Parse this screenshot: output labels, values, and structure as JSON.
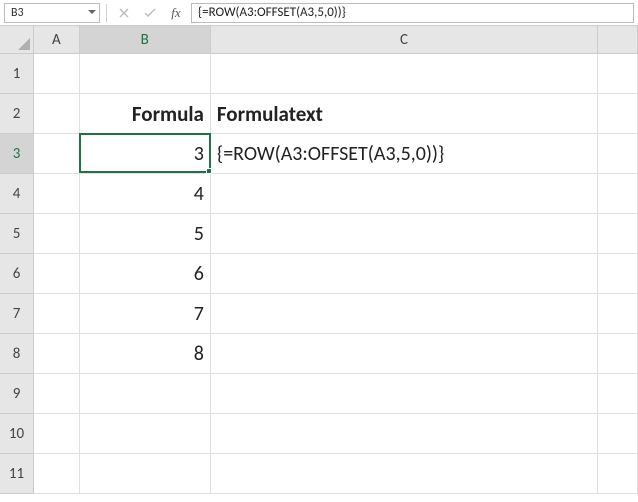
{
  "formula_bar": {
    "name_box": "B3",
    "formula": "{=ROW(A3:OFFSET(A3,5,0))}"
  },
  "columns": [
    {
      "label": "A",
      "width_class": "col-A",
      "active": false
    },
    {
      "label": "B",
      "width_class": "col-B",
      "active": true
    },
    {
      "label": "C",
      "width_class": "col-C",
      "active": false
    },
    {
      "label": "",
      "width_class": "col-D",
      "active": false
    }
  ],
  "rows": [
    {
      "label": "1",
      "active": false
    },
    {
      "label": "2",
      "active": false
    },
    {
      "label": "3",
      "active": true
    },
    {
      "label": "4",
      "active": false
    },
    {
      "label": "5",
      "active": false
    },
    {
      "label": "6",
      "active": false
    },
    {
      "label": "7",
      "active": false
    },
    {
      "label": "8",
      "active": false
    },
    {
      "label": "9",
      "active": false
    },
    {
      "label": "10",
      "active": false
    },
    {
      "label": "11",
      "active": false
    }
  ],
  "cell_data": {
    "B2": {
      "value": "Formula",
      "bold": true,
      "align": "right"
    },
    "C2": {
      "value": "Formulatext",
      "bold": true,
      "align": "left"
    },
    "B3": {
      "value": "3",
      "align": "right"
    },
    "C3": {
      "value": "{=ROW(A3:OFFSET(A3,5,0))}",
      "align": "left"
    },
    "B4": {
      "value": "4",
      "align": "right"
    },
    "B5": {
      "value": "5",
      "align": "right"
    },
    "B6": {
      "value": "6",
      "align": "right"
    },
    "B7": {
      "value": "7",
      "align": "right"
    },
    "B8": {
      "value": "8",
      "align": "right"
    }
  },
  "active_cell": "B3",
  "chart_data": {
    "type": "table",
    "title": "Spreadsheet cells",
    "headers": [
      "Formula",
      "Formulatext"
    ],
    "rows": [
      [
        "3",
        "{=ROW(A3:OFFSET(A3,5,0))}"
      ],
      [
        "4",
        ""
      ],
      [
        "5",
        ""
      ],
      [
        "6",
        ""
      ],
      [
        "7",
        ""
      ],
      [
        "8",
        ""
      ]
    ]
  }
}
